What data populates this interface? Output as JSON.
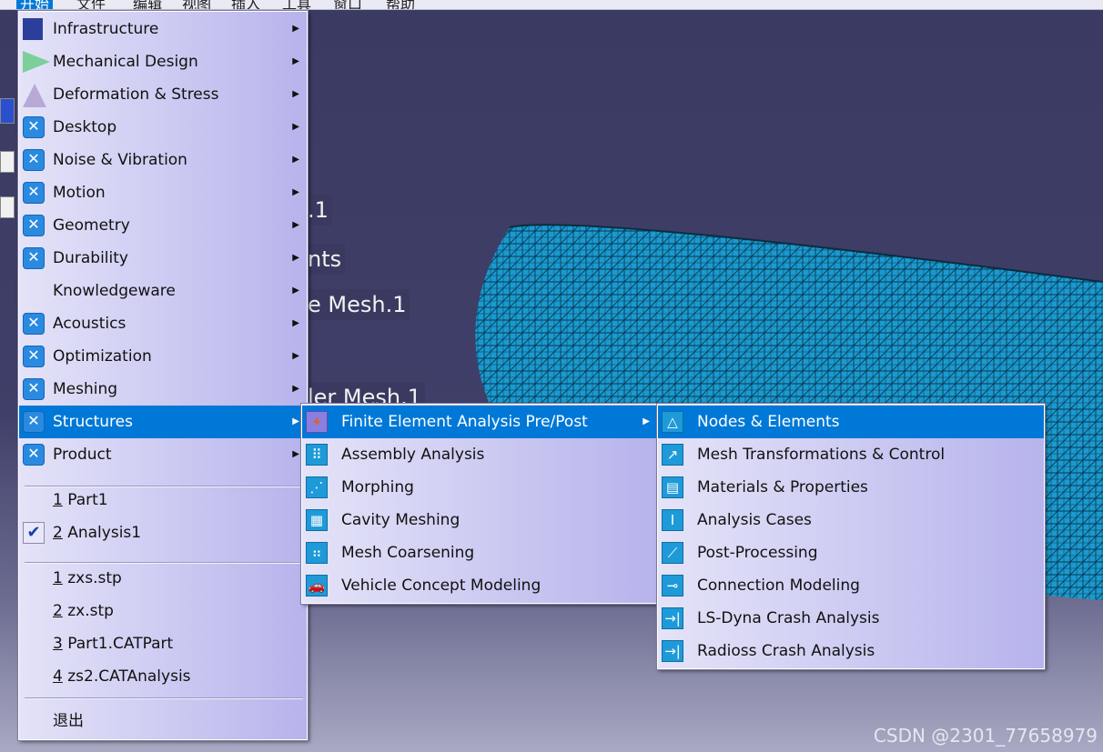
{
  "menubar": {
    "items": [
      "开始",
      "文件",
      "编辑",
      "视图",
      "插入",
      "工具",
      "窗口",
      "帮助"
    ]
  },
  "viewport": {
    "labels": [
      ".1",
      "nts",
      "e Mesh.1",
      "ler Mesh.1"
    ],
    "mesh_color": "#1a9ad0"
  },
  "start_menu": {
    "items": [
      {
        "label": "Infrastructure",
        "icon": "infrastructure-icon",
        "submenu": true
      },
      {
        "label": "Mechanical Design",
        "icon": "mechanical-design-icon",
        "submenu": true
      },
      {
        "label": "Deformation & Stress",
        "icon": "deformation-icon",
        "submenu": true
      },
      {
        "label": "Desktop",
        "icon": "x-workbench-icon",
        "submenu": true
      },
      {
        "label": "Noise & Vibration",
        "icon": "x-workbench-icon",
        "submenu": true
      },
      {
        "label": "Motion",
        "icon": "x-workbench-icon",
        "submenu": true
      },
      {
        "label": "Geometry",
        "icon": "x-workbench-icon",
        "submenu": true
      },
      {
        "label": "Durability",
        "icon": "x-workbench-icon",
        "submenu": true
      },
      {
        "label": "Knowledgeware",
        "icon": "",
        "submenu": true
      },
      {
        "label": "Acoustics",
        "icon": "x-workbench-icon",
        "submenu": true
      },
      {
        "label": "Optimization",
        "icon": "x-workbench-icon",
        "submenu": true
      },
      {
        "label": "Meshing",
        "icon": "x-workbench-icon",
        "submenu": true
      },
      {
        "label": "Structures",
        "icon": "x-workbench-icon",
        "submenu": true
      },
      {
        "label": "Product",
        "icon": "x-workbench-icon",
        "submenu": true
      }
    ],
    "windows": [
      {
        "num": "1",
        "label": " Part1"
      },
      {
        "num": "2",
        "label": " Analysis1"
      }
    ],
    "recent": [
      {
        "num": "1",
        "label": " zxs.stp"
      },
      {
        "num": "2",
        "label": " zx.stp"
      },
      {
        "num": "3",
        "label": " Part1.CATPart"
      },
      {
        "num": "4",
        "label": " zs2.CATAnalysis"
      }
    ],
    "exit_label": "退出"
  },
  "structures_menu": {
    "items": [
      {
        "label": "Finite Element Analysis Pre/Post",
        "icon": "fea-icon"
      },
      {
        "label": "Assembly Analysis",
        "icon": "assembly-icon"
      },
      {
        "label": "Morphing",
        "icon": "morphing-icon"
      },
      {
        "label": "Cavity Meshing",
        "icon": "cavity-icon"
      },
      {
        "label": "Mesh Coarsening",
        "icon": "coarsening-icon"
      },
      {
        "label": "Vehicle Concept Modeling",
        "icon": "vehicle-icon"
      }
    ]
  },
  "fea_menu": {
    "items": [
      {
        "label": "Nodes & Elements",
        "icon": "nodes-icon"
      },
      {
        "label": "Mesh Transformations & Control",
        "icon": "mesh-transform-icon"
      },
      {
        "label": "Materials & Properties",
        "icon": "materials-icon"
      },
      {
        "label": "Analysis Cases",
        "icon": "analysis-cases-icon"
      },
      {
        "label": "Post-Processing",
        "icon": "post-processing-icon"
      },
      {
        "label": "Connection Modeling",
        "icon": "connection-icon"
      },
      {
        "label": "LS-Dyna Crash Analysis",
        "icon": "crash-icon"
      },
      {
        "label": "Radioss Crash Analysis",
        "icon": "crash-icon"
      }
    ]
  },
  "watermark": "CSDN @2301_77658979",
  "colors": {
    "highlight": "#0078d7",
    "menu_bg": "#c9c7f1",
    "bg": "#3f3f69"
  }
}
